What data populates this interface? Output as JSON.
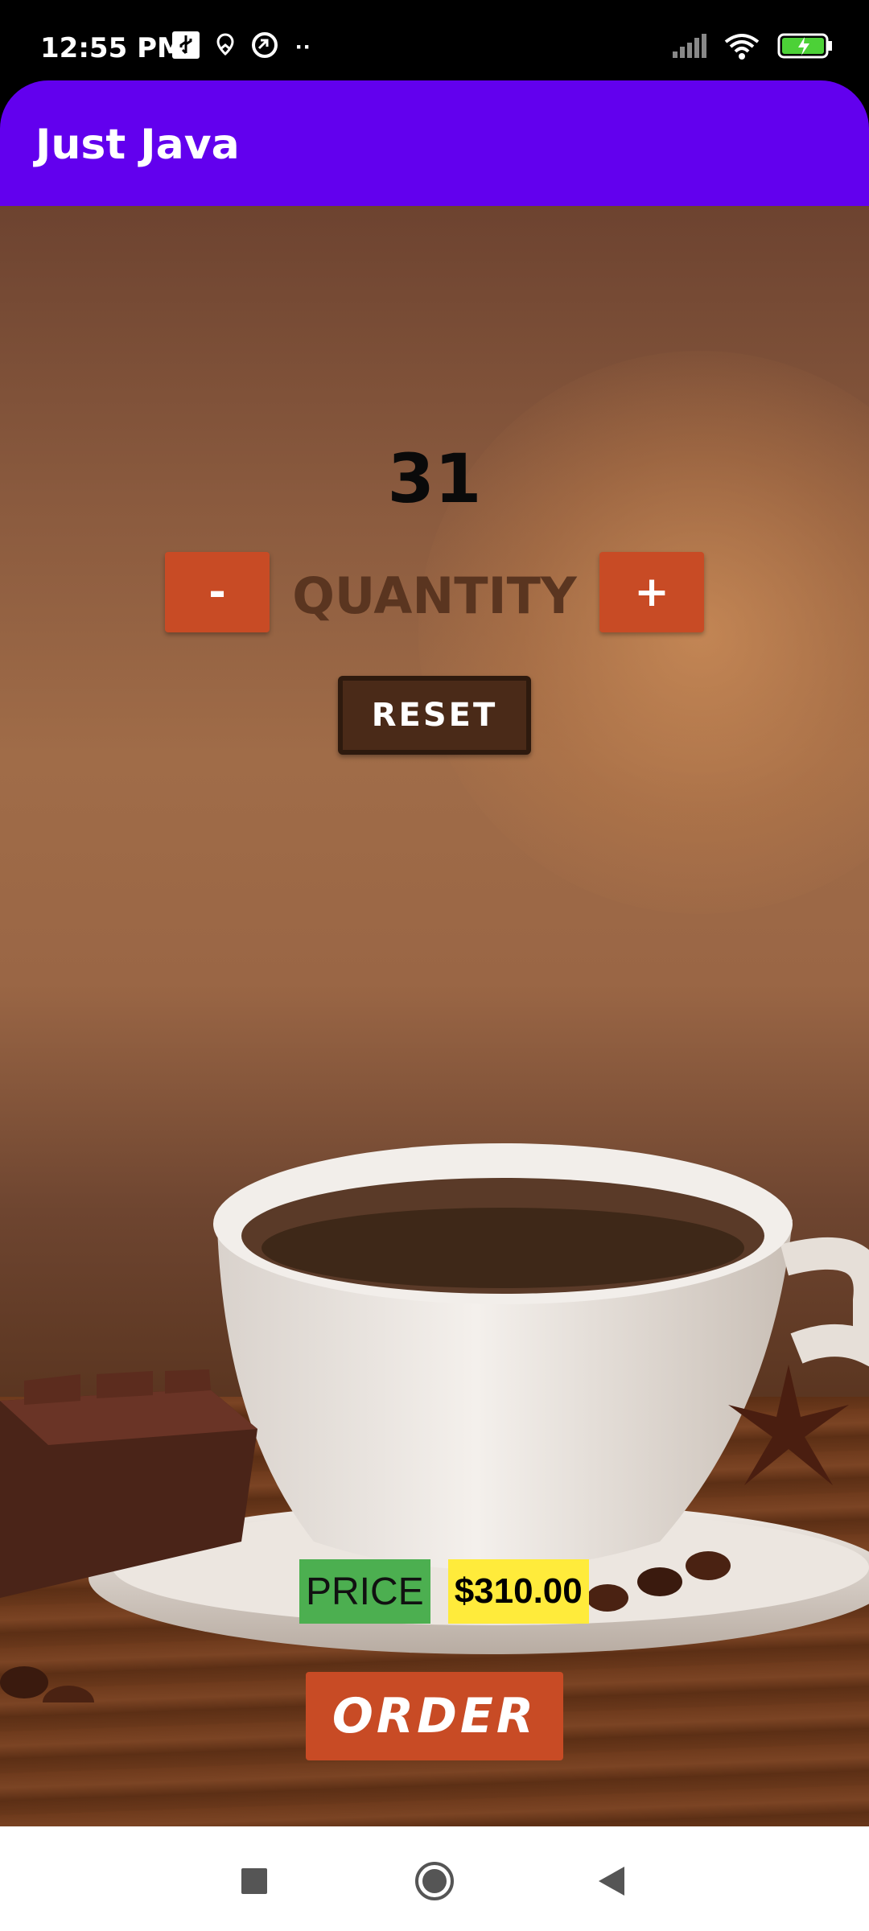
{
  "status_bar": {
    "time": "12:55 PM",
    "extra": "··"
  },
  "app_bar": {
    "title": "Just Java"
  },
  "order": {
    "count": "31",
    "minus_label": "-",
    "plus_label": "+",
    "quantity_label": "QUANTITY",
    "reset_label": "RESET",
    "price_label": "PRICE",
    "price_value": "$310.00",
    "order_label": "ORDER"
  },
  "colors": {
    "app_bar": "#6200ee",
    "button": "#c84b25",
    "reset": "#4a2a18",
    "price_label_bg": "#4caf50",
    "price_value_bg": "#ffeb3b"
  },
  "icons": [
    "usb-icon",
    "location-icon",
    "sync-icon",
    "signal-icon",
    "wifi-icon",
    "battery-charging-icon",
    "recents-icon",
    "home-icon",
    "back-icon"
  ]
}
